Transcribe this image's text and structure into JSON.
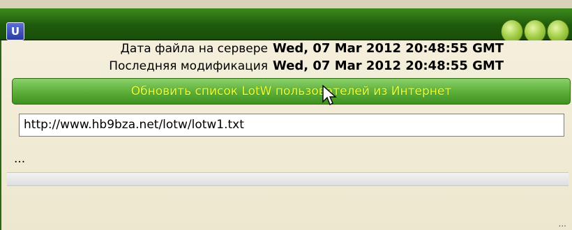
{
  "window": {
    "app_icon_text": "U",
    "app_icon": "app-logo-icon",
    "controls": [
      "minimize-button",
      "maximize-button",
      "close-button"
    ]
  },
  "file_info": {
    "server_date_label": "Дата файла на сервере",
    "server_date_value": "Wed, 07 Mar 2012 20:48:55 GMT",
    "modified_label": "Последняя модификация",
    "modified_value": "Wed, 07 Mar 2012 20:48:55 GMT"
  },
  "update_button": {
    "label": "Обновить список LotW пользователей из Интернет"
  },
  "url_field": {
    "value": "http://www.hb9bza.net/lotw/lotw1.txt"
  },
  "status": {
    "text": "...",
    "progress": 0
  },
  "footer": {
    "grip_text": "..."
  },
  "colors": {
    "titlebar": "#1e5a0c",
    "button_green": "#5fb13b",
    "button_text": "#eaff3a",
    "background": "#efe9d4"
  }
}
